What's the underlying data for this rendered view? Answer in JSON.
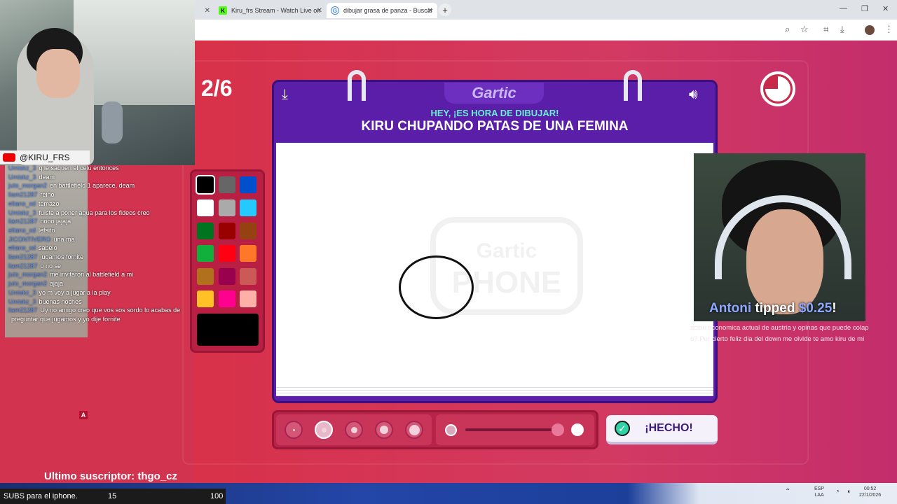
{
  "browser": {
    "tabs": [
      {
        "label": "Kiru_frs Stream - Watch Live on",
        "icon": "kick-icon",
        "color": "#53fc18"
      },
      {
        "label": "dibujar grasa de panza - Buscar",
        "icon": "google-icon",
        "color": "#4285f4"
      }
    ],
    "new_tab": "+"
  },
  "game": {
    "round": "2/6",
    "logo": "Gartic",
    "prompt_hint": "HEY, ¡ES HORA DE DIBUJAR!",
    "prompt": "KIRU CHUPANDO PATAS DE UNA FEMINA",
    "done_label": "¡HECHO!",
    "watermark": "Gartic PHONE",
    "palette": [
      "#000000",
      "#666666",
      "#0050cd",
      "#ffffff",
      "#aaaaaa",
      "#26c9ff",
      "#017420",
      "#990000",
      "#964112",
      "#11b03c",
      "#ff0013",
      "#ff7829",
      "#b0701c",
      "#99004e",
      "#cb5a57",
      "#ffc126",
      "#ff008f",
      "#feafa8"
    ],
    "selected_color": "#000000",
    "brush_sizes": 5,
    "selected_size": 2
  },
  "overlay": {
    "channel_handle": "@KIRU_FRS",
    "chat": [
      {
        "user": "Umiskz_3",
        "msg": "q le saquen el celu entonces"
      },
      {
        "user": "Umiskz_3",
        "msg": "deam"
      },
      {
        "user": "juto_morgan2",
        "msg": "en battlefield 1 aparece, deam"
      },
      {
        "user": "liam21287",
        "msg": "reino"
      },
      {
        "user": "eltano_xd",
        "msg": "temazo"
      },
      {
        "user": "Umiskz_3",
        "msg": "fuiste a poner agua para los fideos creo"
      },
      {
        "user": "liam21287",
        "msg": "nooo jajaja"
      },
      {
        "user": "eltano_xd",
        "msg": "lefsito"
      },
      {
        "user": "JICONTIVERO",
        "msg": "una ma"
      },
      {
        "user": "eltano_xd",
        "msg": "sabelo"
      },
      {
        "user": "liam21287",
        "msg": "jugamos fornite"
      },
      {
        "user": "liam21287",
        "msg": "o no se"
      },
      {
        "user": "juto_morgan2",
        "msg": "me invitaron al battlefield a mi"
      },
      {
        "user": "juto_morgan2",
        "msg": "ajaja"
      },
      {
        "user": "Umiskz_3",
        "msg": "yo m voy a jugar a la play"
      },
      {
        "user": "Umiskz_3",
        "msg": "buenas noches"
      },
      {
        "user": "liam21287",
        "msg": "Uy no amigo creo que vos sos sordo lo acabas de"
      },
      {
        "user": "",
        "msg": "preguntar que jugamos y yo dije fornite"
      }
    ],
    "tip": {
      "name": "Antoni",
      "text": "tipped",
      "amount": "$0.25",
      "suffix": "!"
    },
    "tip_message": [
      "acion economica actual de austria y opinas que puede colap",
      "o? Por cierto feliz dia del down me olvide te amo kiru de mi"
    ],
    "a_badge": "A",
    "last_subscriber": "Ultimo suscriptor: thgo_cz",
    "subs_bar": {
      "label": "SUBS para el iphone.",
      "current": "15",
      "goal": "100"
    }
  },
  "taskbar": {
    "lang": "ESP",
    "lang2": "LAA",
    "time": "00:52",
    "date": "22/1/2026"
  }
}
